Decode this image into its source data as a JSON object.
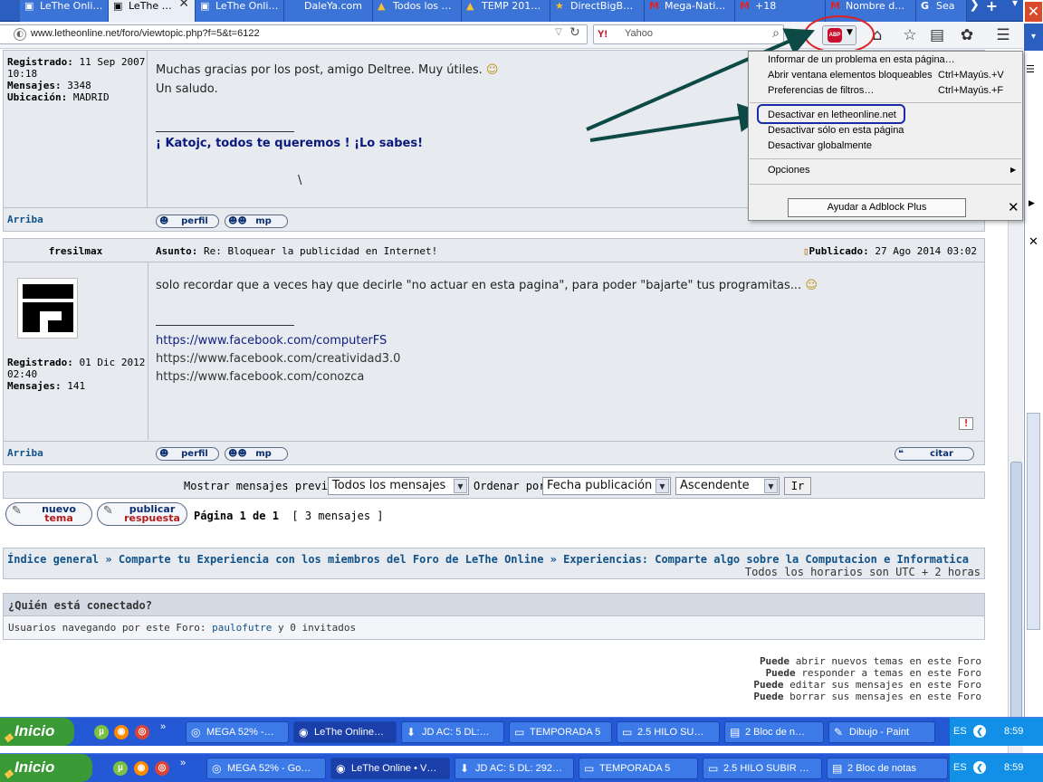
{
  "browser": {
    "tabs": [
      {
        "label": "LeThe Onli…",
        "icon": "monitor-icon",
        "icon_glyph": "▣"
      },
      {
        "label": "LeThe …",
        "icon": "monitor-icon",
        "icon_glyph": "▣",
        "active": true
      },
      {
        "label": "LeThe Onli…",
        "icon": "monitor-icon",
        "icon_glyph": "▣"
      },
      {
        "label": "DaleYa.com",
        "icon": "none",
        "icon_glyph": ""
      },
      {
        "label": "Todos los …",
        "icon": "drive-icon",
        "icon_glyph": "▲"
      },
      {
        "label": "TEMP 201…",
        "icon": "drive-icon",
        "icon_glyph": "▲"
      },
      {
        "label": "DirectBigB…",
        "icon": "star-icon",
        "icon_glyph": "★"
      },
      {
        "label": "Mega-Nati…",
        "icon": "mega-icon",
        "icon_glyph": "M"
      },
      {
        "label": "+18",
        "icon": "mega-icon",
        "icon_glyph": "M"
      },
      {
        "label": "Nombre d…",
        "icon": "mega-icon",
        "icon_glyph": "M"
      },
      {
        "label": "Sea",
        "icon": "google-icon",
        "icon_glyph": "G"
      }
    ],
    "tab_close_glyph": "✕",
    "window_close_glyph": "✕",
    "url": "www.letheonline.net/foro/viewtopic.php?f=5&t=6122",
    "search_engine_label": "Y!",
    "search_placeholder": "Yahoo",
    "abp_label": "ABP"
  },
  "abp_menu": {
    "items": [
      {
        "label": "Informar de un problema en esta página…",
        "shortcut": ""
      },
      {
        "label": "Abrir ventana elementos bloqueables",
        "shortcut": "Ctrl+Mayús.+V"
      },
      {
        "label": "Preferencias de filtros…",
        "shortcut": "Ctrl+Mayús.+F"
      },
      {
        "label": "Desactivar en letheonline.net",
        "shortcut": ""
      },
      {
        "label": "Desactivar sólo en esta página",
        "shortcut": ""
      },
      {
        "label": "Desactivar globalmente",
        "shortcut": ""
      },
      {
        "label": "Opciones",
        "shortcut": ""
      }
    ],
    "help_button": "Ayudar a Adblock Plus",
    "close_glyph": "✕"
  },
  "post1": {
    "registered_label": "Registrado:",
    "registered_value": "11 Sep 2007 10:18",
    "messages_label": "Mensajes:",
    "messages_value": "3348",
    "location_label": "Ubicación:",
    "location_value": "MADRID",
    "body_line1": "Muchas gracias por los post, amigo Deltree. Muy útiles.",
    "body_line2": "Un saludo.",
    "signature": "¡ Katojc, todos te queremos ! ¡Lo sabes!",
    "sig_extra": "\\",
    "top_link": "Arriba",
    "profile_button": "perfil",
    "pm_button": "mp"
  },
  "post2": {
    "author": "fresilmax",
    "subject_label": "Asunto:",
    "subject_value": "Re: Bloquear la publicidad en Internet!",
    "published_label": "Publicado:",
    "published_value": "27 Ago 2014 03:02",
    "body": "solo recordar que a veces hay que decirle \"no actuar en esta pagina\", para poder \"bajarte\" tus programitas...",
    "links": [
      "https://www.facebook.com/computerFS",
      "https://www.facebook.com/creatividad3.0",
      "https://www.facebook.com/conozca"
    ],
    "registered_label": "Registrado:",
    "registered_value": "01 Dic 2012 02:40",
    "messages_label": "Mensajes:",
    "messages_value": "141",
    "top_link": "Arriba",
    "profile_button": "perfil",
    "pm_button": "mp",
    "quote_button": "citar",
    "report_glyph": "!"
  },
  "sort_bar": {
    "show_label": "Mostrar mensajes previos:",
    "show_value": "Todos los mensajes",
    "order_label": "Ordenar por",
    "order_value": "Fecha publicación",
    "direction_value": "Ascendente",
    "go_button": "Ir"
  },
  "actions": {
    "new_topic_line1": "nuevo",
    "new_topic_line2": "tema",
    "reply_line1": "publicar",
    "reply_line2": "respuesta",
    "pagination_main": "Página 1 de 1",
    "pagination_count": "[ 3 mensajes ]"
  },
  "breadcrumb": {
    "text": "Índice general » Comparte tu Experiencia con los miembros del Foro de LeThe Online » Experiencias: Comparte algo sobre la Computacion e Informatica",
    "timezone": "Todos los horarios son UTC + 2 horas"
  },
  "online": {
    "title": "¿Quién está conectado?",
    "prefix": "Usuarios navegando por este Foro:",
    "user": "paulofutre",
    "suffix": "y 0 invitados"
  },
  "permissions": [
    {
      "verb": "Puede",
      "rest": "abrir nuevos temas en este Foro"
    },
    {
      "verb": "Puede",
      "rest": "responder a temas en este Foro"
    },
    {
      "verb": "Puede",
      "rest": "editar sus mensajes en este Foro"
    },
    {
      "verb": "Puede",
      "rest": "borrar sus mensajes en este Foro"
    }
  ],
  "taskbar1": {
    "start_label": "Inicio",
    "tasks": [
      {
        "label": "MEGA 52% -…",
        "icon": "chrome-icon"
      },
      {
        "label": "LeThe Online…",
        "icon": "firefox-icon",
        "active": true
      },
      {
        "label": "JD AC: 5 DL:…",
        "icon": "jdownloader-icon"
      },
      {
        "label": "TEMPORADA 5",
        "icon": "folder-icon"
      },
      {
        "label": "2.5 HILO SU…",
        "icon": "folder-icon"
      },
      {
        "label": "2 Bloc de n…",
        "icon": "notepad-icon"
      },
      {
        "label": "Dibujo - Paint",
        "icon": "paint-icon"
      }
    ],
    "lang": "ES",
    "clock": "8:59"
  },
  "taskbar2": {
    "start_label": "Inicio",
    "tasks": [
      {
        "label": "MEGA 52% - Go…",
        "icon": "chrome-icon"
      },
      {
        "label": "LeThe Online • V…",
        "icon": "firefox-icon",
        "active": true
      },
      {
        "label": "JD AC: 5 DL: 292…",
        "icon": "jdownloader-icon"
      },
      {
        "label": "TEMPORADA 5",
        "icon": "folder-icon"
      },
      {
        "label": "2.5 HILO SUBIR …",
        "icon": "folder-icon"
      },
      {
        "label": "2 Bloc de notas",
        "icon": "notepad-icon"
      }
    ],
    "lang": "ES",
    "clock": "8:59"
  },
  "colors": {
    "accent": "#105289",
    "annotation_red": "#e02020",
    "annotation_blue": "#1a2ba8",
    "annotation_arrow": "#0e4a45",
    "taskbar": "#2458d4"
  }
}
